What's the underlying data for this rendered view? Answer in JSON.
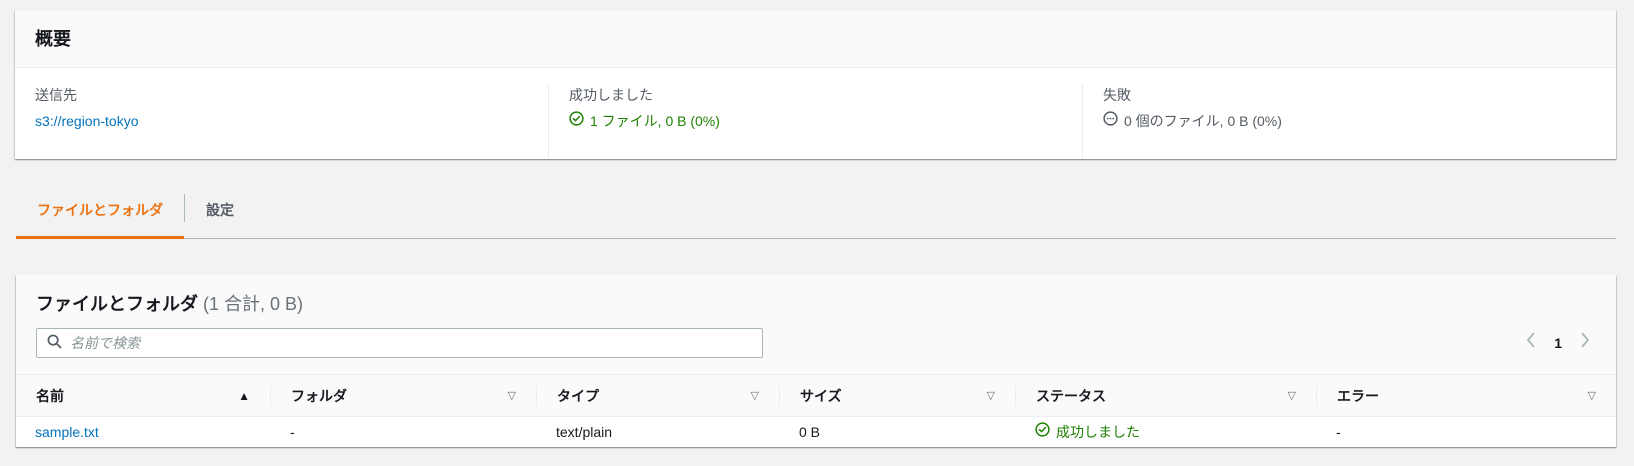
{
  "summary": {
    "title": "概要",
    "destination_label": "送信先",
    "destination_value": "s3://region-tokyo",
    "succeeded_label": "成功しました",
    "succeeded_value": "1 ファイル, 0 B (0%)",
    "failed_label": "失敗",
    "failed_value": "0 個のファイル, 0 B (0%)"
  },
  "tabs": [
    {
      "label": "ファイルとフォルダ",
      "active": true
    },
    {
      "label": "設定",
      "active": false
    }
  ],
  "files": {
    "title": "ファイルとフォルダ",
    "count": "(1 合計, 0 B)",
    "search_placeholder": "名前で検索",
    "page_current": "1",
    "columns": [
      "名前",
      "フォルダ",
      "タイプ",
      "サイズ",
      "ステータス",
      "エラー"
    ],
    "rows": [
      {
        "name": "sample.txt",
        "folder": "-",
        "type": "text/plain",
        "size": "0 B",
        "status": "成功しました",
        "error": "-"
      }
    ]
  },
  "colors": {
    "link": "#0073bb",
    "success": "#1d8102",
    "tab_active": "#ec7211"
  }
}
